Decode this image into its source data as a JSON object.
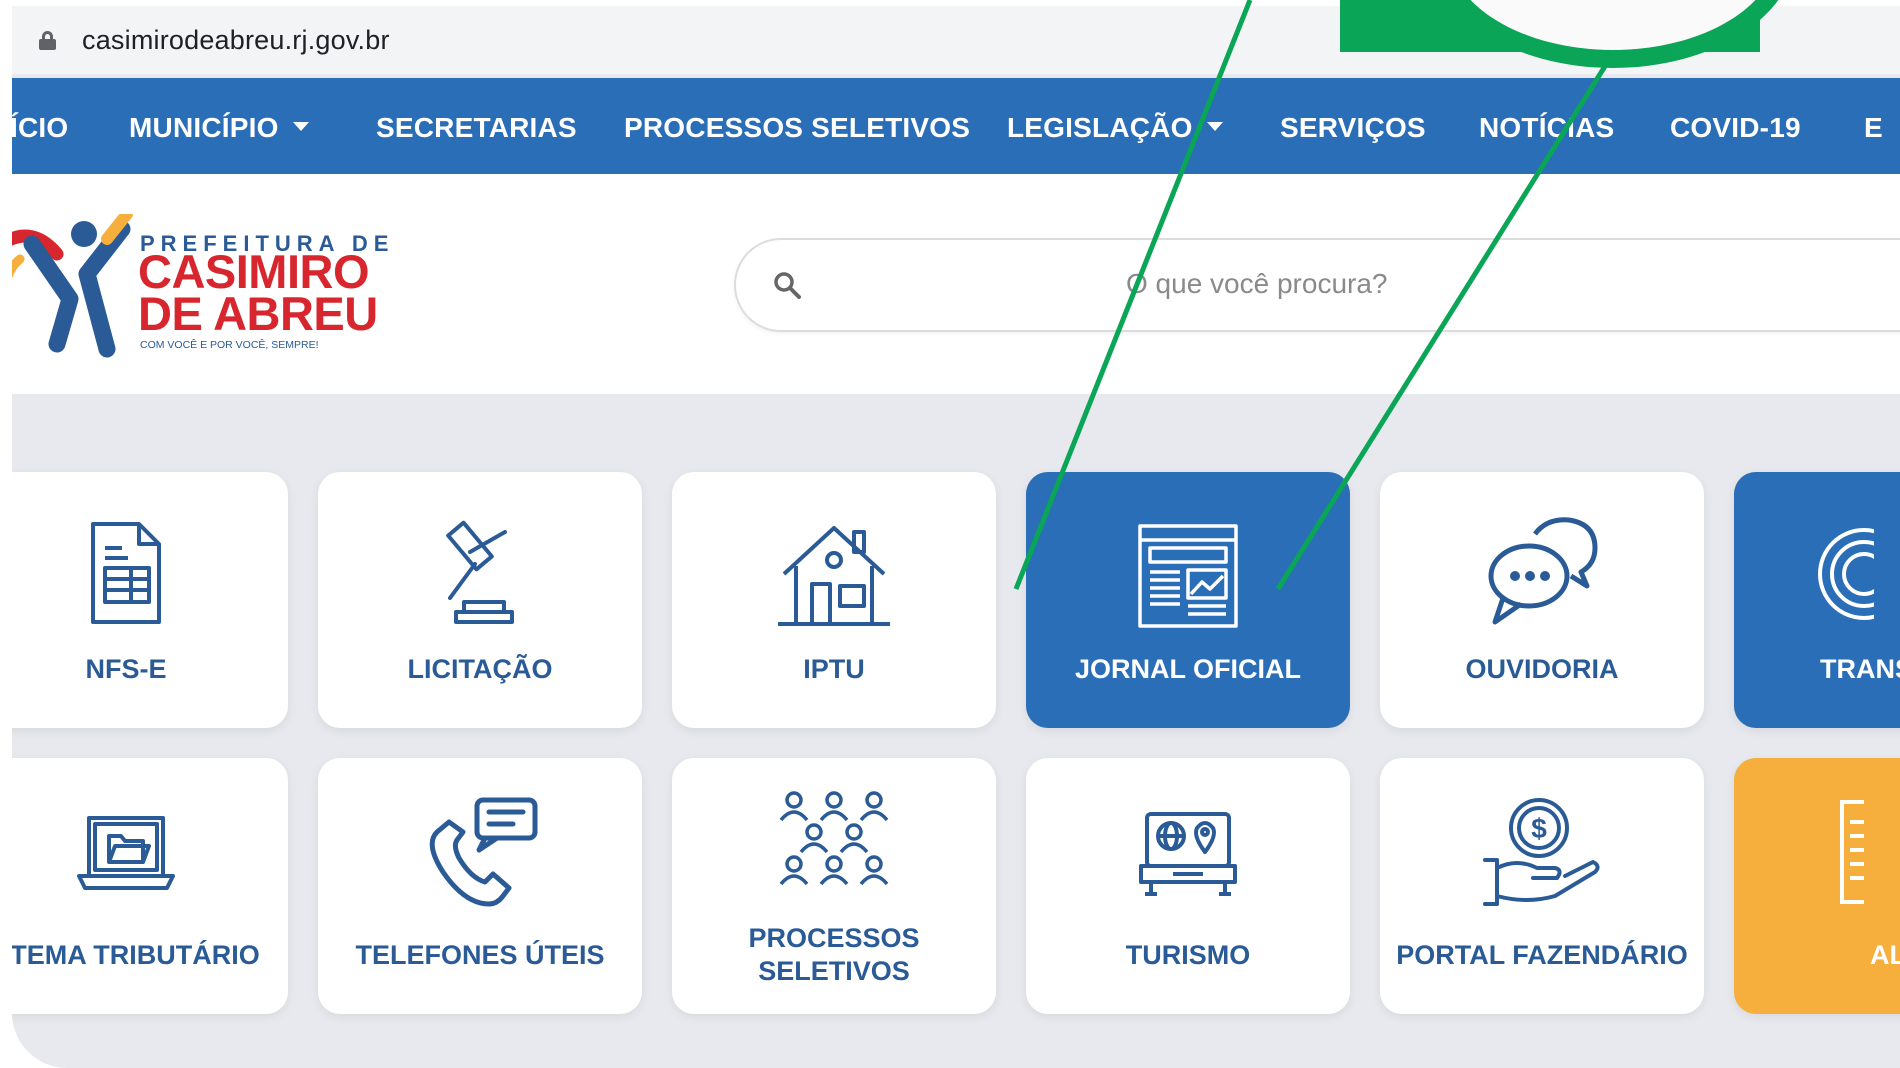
{
  "browser": {
    "url": "casimirodeabreu.rj.gov.br"
  },
  "nav": {
    "items": [
      {
        "label": "ÍCIO"
      },
      {
        "label": "MUNICÍPIO"
      },
      {
        "label": "SECRETARIAS"
      },
      {
        "label": "PROCESSOS SELETIVOS"
      },
      {
        "label": "LEGISLAÇÃO"
      },
      {
        "label": "SERVIÇOS"
      },
      {
        "label": "NOTÍCIAS"
      },
      {
        "label": "COVID-19"
      },
      {
        "label": "E"
      }
    ]
  },
  "logo": {
    "line1": "PREFEITURA DE",
    "line2": "CASIMIRO",
    "line3": "DE ABREU",
    "slogan": "COM VOCÊ E POR VOCÊ, SEMPRE!"
  },
  "search": {
    "placeholder": "O que você procura?"
  },
  "tiles": [
    {
      "label": "NFS-E",
      "icon": "document-icon"
    },
    {
      "label": "LICITAÇÃO",
      "icon": "gavel-icon"
    },
    {
      "label": "IPTU",
      "icon": "house-icon"
    },
    {
      "label": "JORNAL OFICIAL",
      "icon": "newspaper-icon"
    },
    {
      "label": "OUVIDORIA",
      "icon": "chat-icon"
    },
    {
      "label": "TRANS",
      "icon": "transparency-icon"
    },
    {
      "label": "STEMA TRIBUTÁRIO",
      "icon": "laptop-folder-icon"
    },
    {
      "label": "TELEFONES ÚTEIS",
      "icon": "phone-icon"
    },
    {
      "label": "PROCESSOS\nSELETIVOS",
      "icon": "people-icon"
    },
    {
      "label": "TURISMO",
      "icon": "tourism-icon"
    },
    {
      "label": "PORTAL FAZENDÁRIO",
      "icon": "money-hand-icon"
    },
    {
      "label": "AL",
      "icon": "document-icon"
    }
  ],
  "colors": {
    "nav": "#2a6eb8",
    "label": "#2a5b96",
    "accent_green": "#0aa556",
    "orange": "#f6ae3d",
    "logo_red": "#d7262e"
  }
}
